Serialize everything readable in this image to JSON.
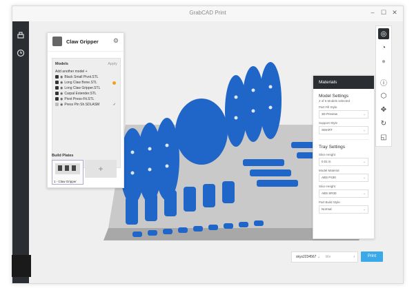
{
  "window": {
    "title": "GrabCAD Print",
    "controls": [
      "–",
      "☐",
      "✕"
    ]
  },
  "left_rail": {
    "items": [
      "printer-icon",
      "history-icon"
    ]
  },
  "project_panel": {
    "name": "Claw Gripper",
    "models_label": "Models",
    "apply_label": "Apply",
    "add_model_label": "Add another model",
    "models": [
      {
        "name": "Black Small Pivot.STL",
        "checked": true,
        "badge": false
      },
      {
        "name": "Long Claw Bone.STL",
        "checked": true,
        "badge": true
      },
      {
        "name": "Long Claw Gripper.STL",
        "checked": true,
        "badge": false
      },
      {
        "name": "Carpal Extender.STL",
        "checked": true,
        "badge": false
      },
      {
        "name": "Pivot Press-Fit.STL",
        "checked": true,
        "badge": false
      },
      {
        "name": "Press Pin Sh.SDLASM",
        "checked": false,
        "badge": false
      }
    ],
    "build_plates_label": "Build Plates",
    "plates": [
      {
        "label": "1 - Claw Gripper"
      }
    ],
    "add_plate_label": "+"
  },
  "right_toolbar": {
    "icons": [
      "view-cube-icon",
      "clock-estimate-icon",
      "sphere-icon",
      "info-icon",
      "cube-icon",
      "move-icon",
      "rotate-icon",
      "scale-icon"
    ]
  },
  "materials_panel": {
    "header": "Materials",
    "model_settings": {
      "title": "Model Settings",
      "subtitle": "2 of 6 Models selected",
      "part_fill_label": "Part Fill Style",
      "part_fill_value": "3D Preview",
      "support_label": "Support Style",
      "support_value": "SMART"
    },
    "tray_settings": {
      "title": "Tray Settings",
      "slice_height_label": "Slice Height",
      "slice_height_value": "0.01 in",
      "model_material_label": "Model Material",
      "model_material_value": "ABS P430",
      "slice_height2_label": "Slice Height",
      "slice_height2_value": "ABS SR30",
      "build_style_label": "Part Build Style",
      "build_style_value": "Normal"
    }
  },
  "bottom_bar": {
    "printer_name": "skys2234567",
    "title_placeholder": "title",
    "print_label": "Print"
  },
  "colors": {
    "model_blue": "#1f66c8",
    "accent": "#3aa9ea",
    "dark": "#2a2d31"
  }
}
